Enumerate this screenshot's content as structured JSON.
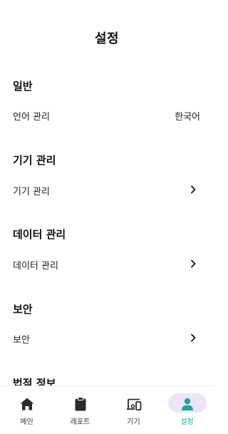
{
  "header": {
    "title": "설정"
  },
  "sections": {
    "general": {
      "title": "일반",
      "row_label": "언어 관리",
      "row_value": "한국어"
    },
    "device": {
      "title": "기기 관리",
      "row_label": "기기 관리"
    },
    "data": {
      "title": "데이터 관리",
      "row_label": "데이터 관리"
    },
    "security": {
      "title": "보안",
      "row_label": "보안"
    },
    "legal": {
      "title": "법적 정보"
    }
  },
  "nav": {
    "items": [
      {
        "label": "메인",
        "icon": "home-icon"
      },
      {
        "label": "레포트",
        "icon": "clipboard-icon"
      },
      {
        "label": "기기",
        "icon": "devices-icon"
      },
      {
        "label": "설정",
        "icon": "person-icon"
      }
    ],
    "active_index": 3
  },
  "colors": {
    "accent": "#1aa8a2",
    "active_pill": "#ece5f8"
  }
}
